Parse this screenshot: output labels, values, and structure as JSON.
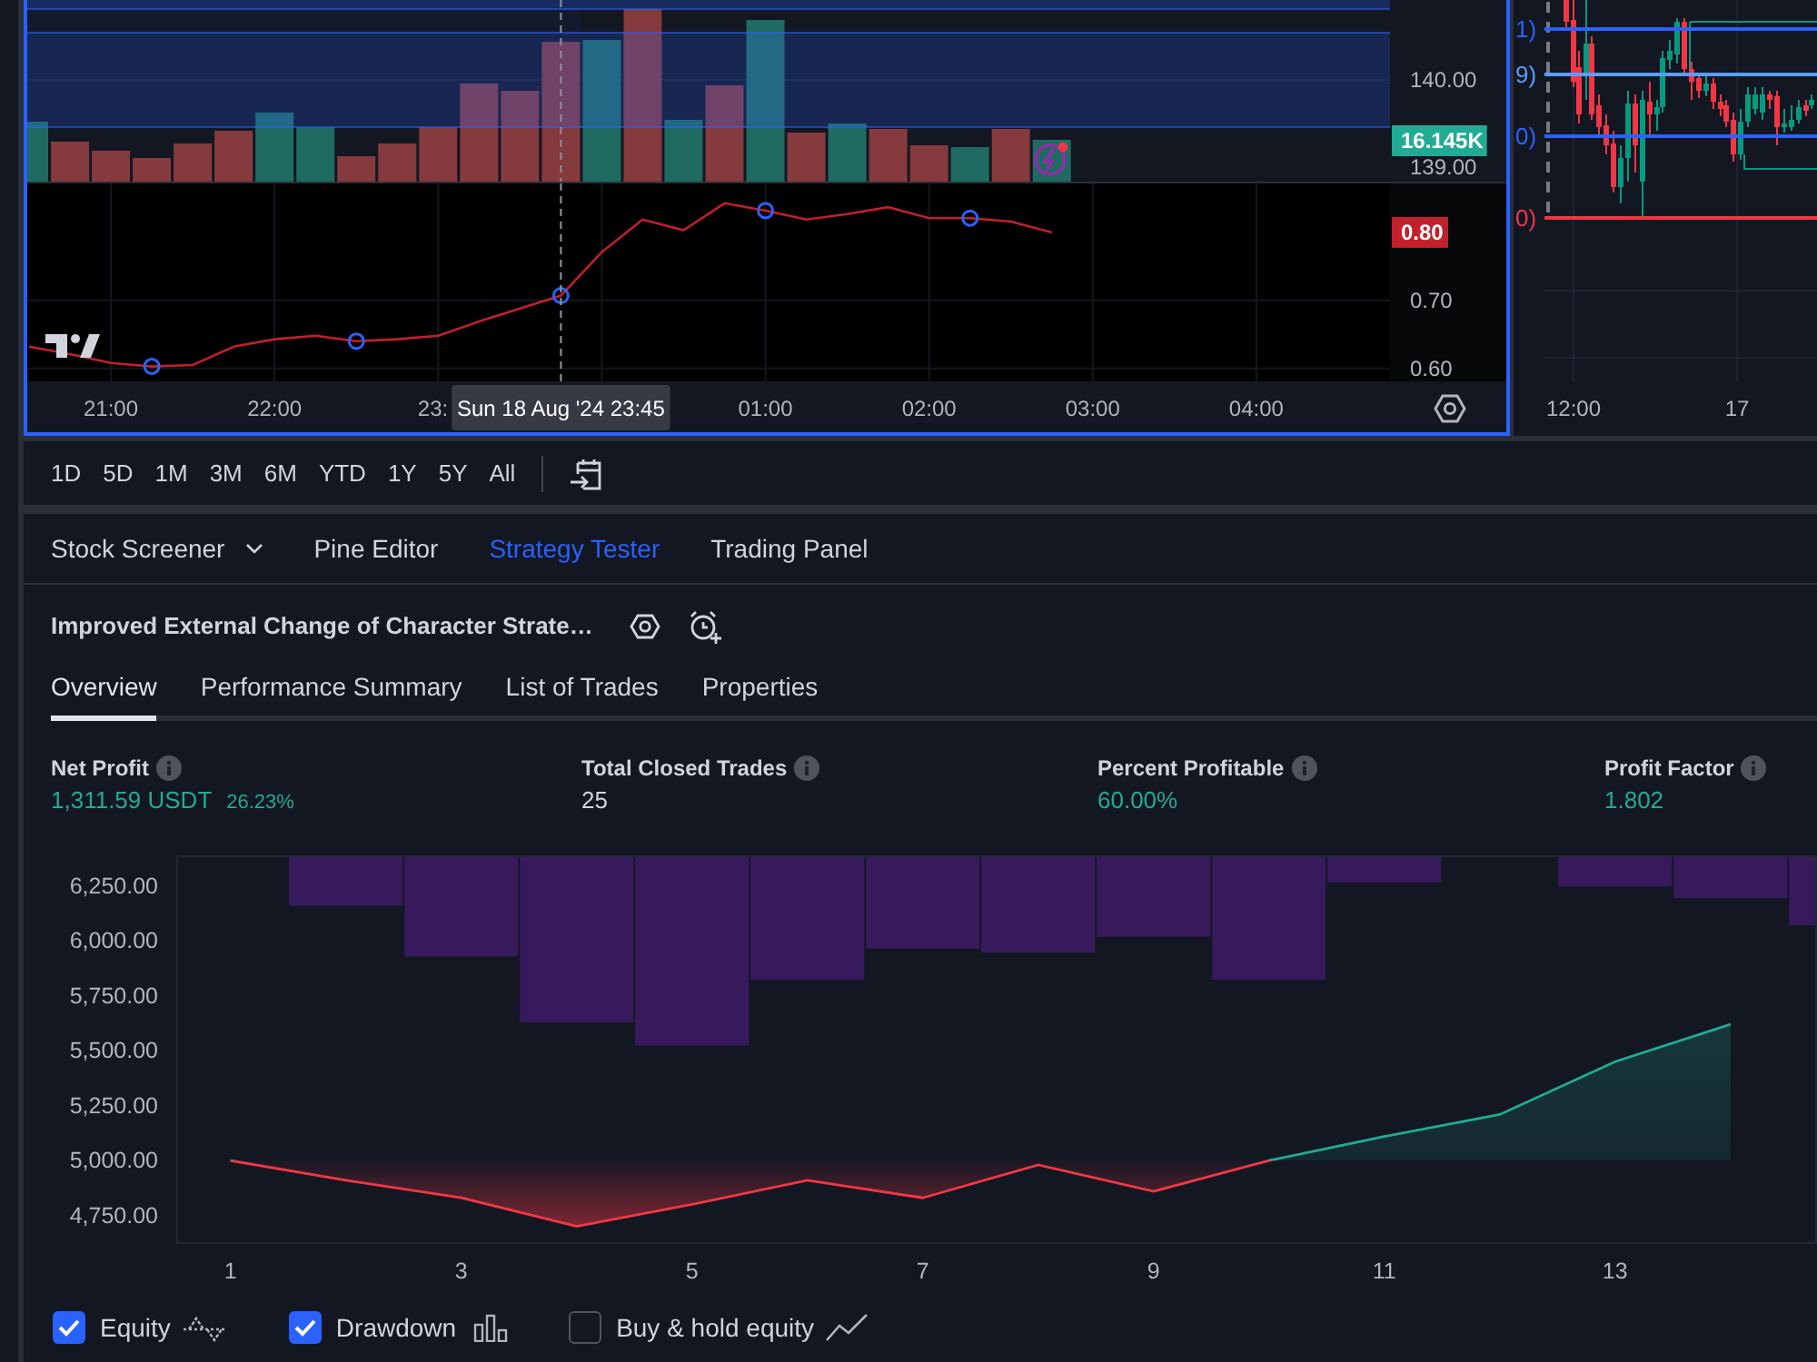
{
  "main_chart": {
    "price_labels": [
      "140.00",
      "139.00"
    ],
    "volume_value": "16.145K",
    "last_value": "0.80",
    "chart_data": [
      {
        "type": "line",
        "grid": true,
        "xlim": [
          "2024-08-18T20:29",
          "2024-08-19T04:49"
        ],
        "ylim": [
          0.581,
          0.872
        ],
        "xticks": [
          {
            "value": "2024-08-18T21:00",
            "label": "21:00"
          },
          {
            "value": "2024-08-18T22:00",
            "label": "22:00"
          },
          {
            "value": "2024-08-18T23:00",
            "label": "23:"
          },
          {
            "value": "2024-08-19T01:00",
            "label": "01:00"
          },
          {
            "value": "2024-08-19T02:00",
            "label": "02:00"
          },
          {
            "value": "2024-08-19T03:00",
            "label": "03:00"
          },
          {
            "value": "2024-08-19T04:00",
            "label": "04:00"
          }
        ],
        "yticks": [
          {
            "value": 0.6,
            "label": "0.60"
          },
          {
            "value": 0.7,
            "label": "0.70"
          }
        ],
        "ref_lines": [
          {
            "axis": "x",
            "value": "2024-08-18T23:45",
            "label": "Sun 18 Aug '24 23:45",
            "color": "#9598a1",
            "line_style": "dashed"
          }
        ],
        "series": [
          {
            "color": "#c2202a",
            "x": [
              "2024-08-18T20:30",
              "2024-08-18T20:45",
              "2024-08-18T21:00",
              "2024-08-18T21:15",
              "2024-08-18T21:30",
              "2024-08-18T21:45",
              "2024-08-18T22:00",
              "2024-08-18T22:15",
              "2024-08-18T22:30",
              "2024-08-18T22:45",
              "2024-08-18T23:00",
              "2024-08-18T23:15",
              "2024-08-18T23:30",
              "2024-08-18T23:45",
              "2024-08-19T00:00",
              "2024-08-19T00:15",
              "2024-08-19T00:30",
              "2024-08-19T00:45",
              "2024-08-19T01:00",
              "2024-08-19T01:15",
              "2024-08-19T01:30",
              "2024-08-19T01:45",
              "2024-08-19T02:00",
              "2024-08-19T02:15",
              "2024-08-19T02:30",
              "2024-08-19T02:45"
            ],
            "values": [
              0.632,
              0.621,
              0.608,
              0.603,
              0.605,
              0.632,
              0.643,
              0.648,
              0.64,
              0.643,
              0.648,
              0.669,
              0.688,
              0.707,
              0.771,
              0.819,
              0.803,
              0.843,
              0.832,
              0.819,
              0.827,
              0.837,
              0.821,
              0.821,
              0.816,
              0.8
            ]
          },
          {
            "type": "scatter",
            "marker": "circle",
            "color": "#2962ff",
            "x": [
              "2024-08-18T21:15",
              "2024-08-18T22:30",
              "2024-08-18T23:45",
              "2024-08-19T01:00",
              "2024-08-19T02:15"
            ],
            "values": [
              0.603,
              0.64,
              0.707,
              0.832,
              0.821
            ]
          }
        ]
      }
    ]
  },
  "side_chart": {
    "levels": [
      {
        "label": "1)",
        "color": "#2962ff"
      },
      {
        "label": "9)",
        "color": "#5b9cf6"
      },
      {
        "label": "0)",
        "color": "#2962ff"
      },
      {
        "label": "0)",
        "color": "#f23645"
      }
    ],
    "time_labels": [
      "12:00",
      "17"
    ]
  },
  "range_buttons": [
    "1D",
    "5D",
    "1M",
    "3M",
    "6M",
    "YTD",
    "1Y",
    "5Y",
    "All"
  ],
  "panel_tabs": [
    {
      "label": "Stock Screener",
      "selected": false,
      "dropdown": true
    },
    {
      "label": "Pine Editor",
      "selected": false,
      "dropdown": false
    },
    {
      "label": "Strategy Tester",
      "selected": true,
      "dropdown": false
    },
    {
      "label": "Trading Panel",
      "selected": false,
      "dropdown": false
    }
  ],
  "strategy": {
    "title": "Improved External Change of Character Strate…"
  },
  "report_tabs": [
    {
      "label": "Overview",
      "selected": true
    },
    {
      "label": "Performance Summary",
      "selected": false
    },
    {
      "label": "List of Trades",
      "selected": false
    },
    {
      "label": "Properties",
      "selected": false
    }
  ],
  "metrics": [
    {
      "label": "Net Profit",
      "value": "1,311.59 USDT",
      "percent": "26.23%",
      "positive": true
    },
    {
      "label": "Total Closed Trades",
      "value": "25",
      "positive": false
    },
    {
      "label": "Percent Profitable",
      "value": "60.00%",
      "positive": true
    },
    {
      "label": "Profit Factor",
      "value": "1.802",
      "positive": true
    }
  ],
  "equity_chart": {
    "chart_data": [
      {
        "type": "area",
        "x": [
          1,
          2,
          3,
          4,
          5,
          6,
          7,
          8,
          9,
          10,
          11,
          12,
          13,
          14
        ],
        "xlim": [
          0.53,
          14.75
        ],
        "ylim": [
          4620,
          6390
        ],
        "xticks": [
          1,
          3,
          5,
          7,
          9,
          11,
          13
        ],
        "yticks": [
          {
            "value": 4750,
            "label": "4,750.00"
          },
          {
            "value": 5000,
            "label": "5,000.00"
          },
          {
            "value": 5250,
            "label": "5,250.00"
          },
          {
            "value": 5500,
            "label": "5,500.00"
          },
          {
            "value": 5750,
            "label": "5,750.00"
          },
          {
            "value": 6000,
            "label": "6,000.00"
          },
          {
            "value": 6250,
            "label": "6,250.00"
          }
        ],
        "colors": [
          "#f23645",
          "#f23645",
          "#f23645",
          "#f23645",
          "#f23645",
          "#f23645",
          "#f23645",
          "#f23645",
          "#f23645",
          "#22ab94",
          "#22ab94",
          "#22ab94",
          "#22ab94",
          "#22ab94"
        ],
        "values": [
          5000,
          4910,
          4830,
          4700,
          4800,
          4910,
          4830,
          4980,
          4860,
          5000,
          5110,
          5210,
          5450,
          5620
        ]
      }
    ]
  },
  "legend": [
    {
      "label": "Equity",
      "checked": true,
      "kind": "equity"
    },
    {
      "label": "Drawdown",
      "checked": true,
      "kind": "drawdown"
    },
    {
      "label": "Buy & hold equity",
      "checked": false,
      "kind": "buy_hold"
    }
  ]
}
